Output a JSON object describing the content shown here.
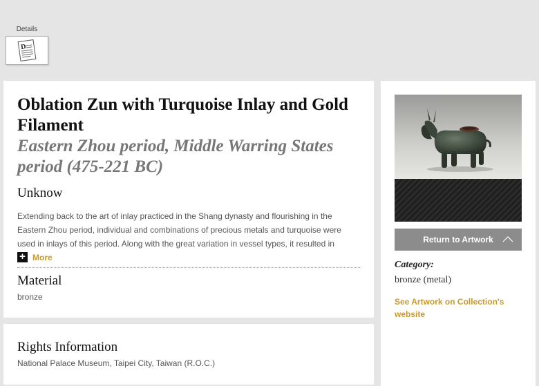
{
  "details_tab": {
    "label": "Details",
    "icon": "document-icon",
    "icon_letter": "D"
  },
  "artwork": {
    "title": "Oblation Zun with Turquoise Inlay and Gold Filament",
    "period": "Eastern Zhou period, Middle Warring States period (475-221 BC)",
    "artist": "Unknow",
    "description": "Extending back to the art of inlay practiced in the Shang dynasty and flourishing in the Eastern Zhou period, individual and combinations of precious metals and turquoise were used in inlays of this period. Along with the great variation in vessel types, it resulted in",
    "more_label": "More",
    "material_heading": "Material",
    "material_value": "bronze",
    "rights_heading": "Rights Information",
    "rights_value": "National Palace Museum, Taipei City, Taiwan (R.O.C.)"
  },
  "sidebar": {
    "return_label": "Return to Artwork",
    "category_label": "Category:",
    "category_value": "bronze (metal)",
    "see_link": "See Artwork on Collection's website"
  },
  "colors": {
    "accent": "#c89a2a",
    "button_gray": "#8c8c8c",
    "background": "#e5e5e5"
  }
}
